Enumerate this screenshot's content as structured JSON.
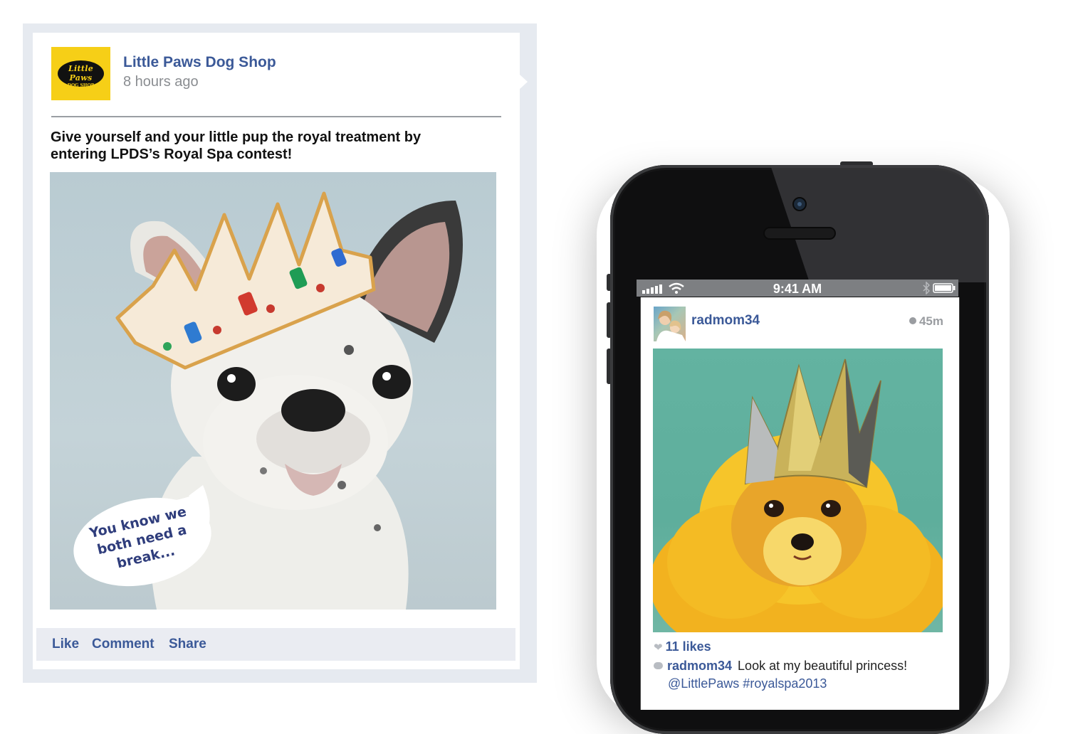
{
  "facebook_post": {
    "page_name": "Little Paws Dog Shop",
    "timestamp": "8 hours ago",
    "logo_text_top": "Little Paws",
    "logo_text_bottom": "DOG SHOP",
    "message": "Give yourself and your little pup the royal treatment by entering LPDS’s Royal Spa contest!",
    "speech_bubble_lines": [
      "You know we",
      "both need a",
      "break..."
    ],
    "actions": {
      "like": "Like",
      "comment": "Comment",
      "share": "Share"
    },
    "image_icon": "crowned-bulldog-photo"
  },
  "phone": {
    "status_bar": {
      "time": "9:41 AM",
      "icons": [
        "signal-icon",
        "wifi-icon",
        "bluetooth-icon",
        "battery-icon"
      ]
    },
    "instagram_post": {
      "username": "radmom34",
      "age": "45m",
      "image_icon": "crowned-pomeranian-photo",
      "likes": "11 likes",
      "caption_user": "radmom34",
      "caption_text": "Look at my beautiful princess!",
      "caption_tags": "@LittlePaws #royalspa2013"
    }
  },
  "colors": {
    "facebook_blue": "#3b5998",
    "logo_yellow": "#f6cf17",
    "frame_gray": "#e6eaf0",
    "status_gray": "#7d7f82",
    "ig_background": "#5eae9c"
  }
}
